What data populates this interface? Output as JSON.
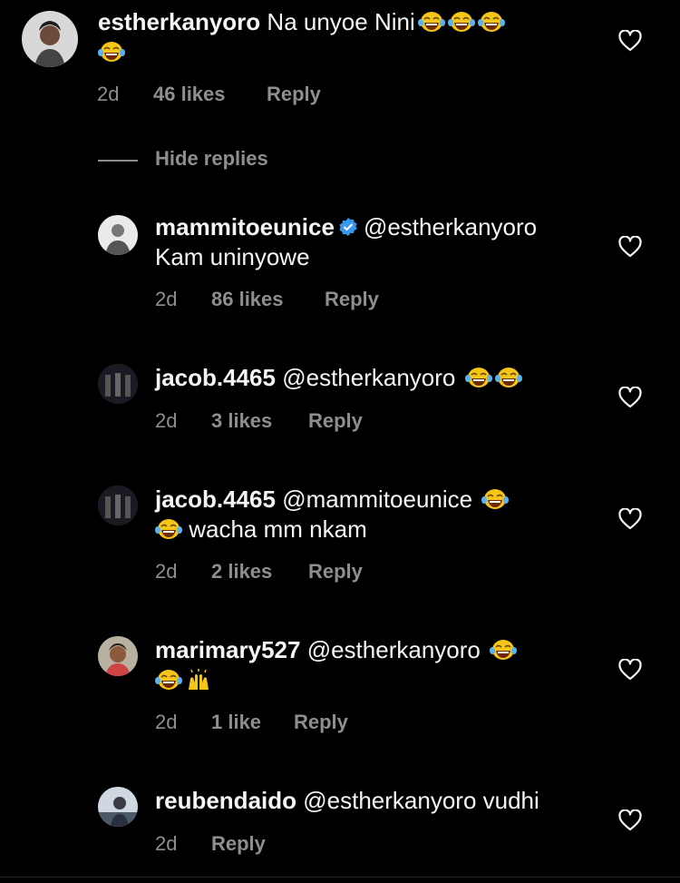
{
  "comments": [
    {
      "username": "estherkanyoro",
      "text": "Na unyoe Nini",
      "emoji": "😂😂😂😂",
      "time": "2d",
      "likes": "46 likes",
      "reply": "Reply"
    },
    {
      "username": "mammitoeunice",
      "mention": "@estherkanyoro",
      "text": "Kam uninyowe",
      "time": "2d",
      "likes": "86 likes",
      "reply": "Reply"
    },
    {
      "username": "jacob.4465",
      "mention": "@estherkanyoro",
      "emoji": "😂😂",
      "time": "2d",
      "likes": "3 likes",
      "reply": "Reply"
    },
    {
      "username": "jacob.4465",
      "mention": "@mammitoeunice",
      "emoji": "😂😂",
      "text": "wacha mm nkam",
      "time": "2d",
      "likes": "2 likes",
      "reply": "Reply"
    },
    {
      "username": "marimary527",
      "mention": "@estherkanyoro",
      "emoji": "😂😂🙌",
      "time": "2d",
      "likes": "1 like",
      "reply": "Reply"
    },
    {
      "username": "reubendaido",
      "mention": "@estherkanyoro",
      "text": "vudhi",
      "time": "2d",
      "reply": "Reply"
    }
  ],
  "hide_replies": "Hide replies",
  "icons": {
    "like": "heart-icon",
    "verified": "verified-badge-icon",
    "laugh": "tears-of-joy-emoji",
    "raised_hands": "raised-hands-emoji"
  },
  "colors": {
    "background": "#000000",
    "text": "#f5f5f5",
    "meta": "#8e8e8e",
    "verified": "#3897f0",
    "emoji": "#f5c518"
  }
}
